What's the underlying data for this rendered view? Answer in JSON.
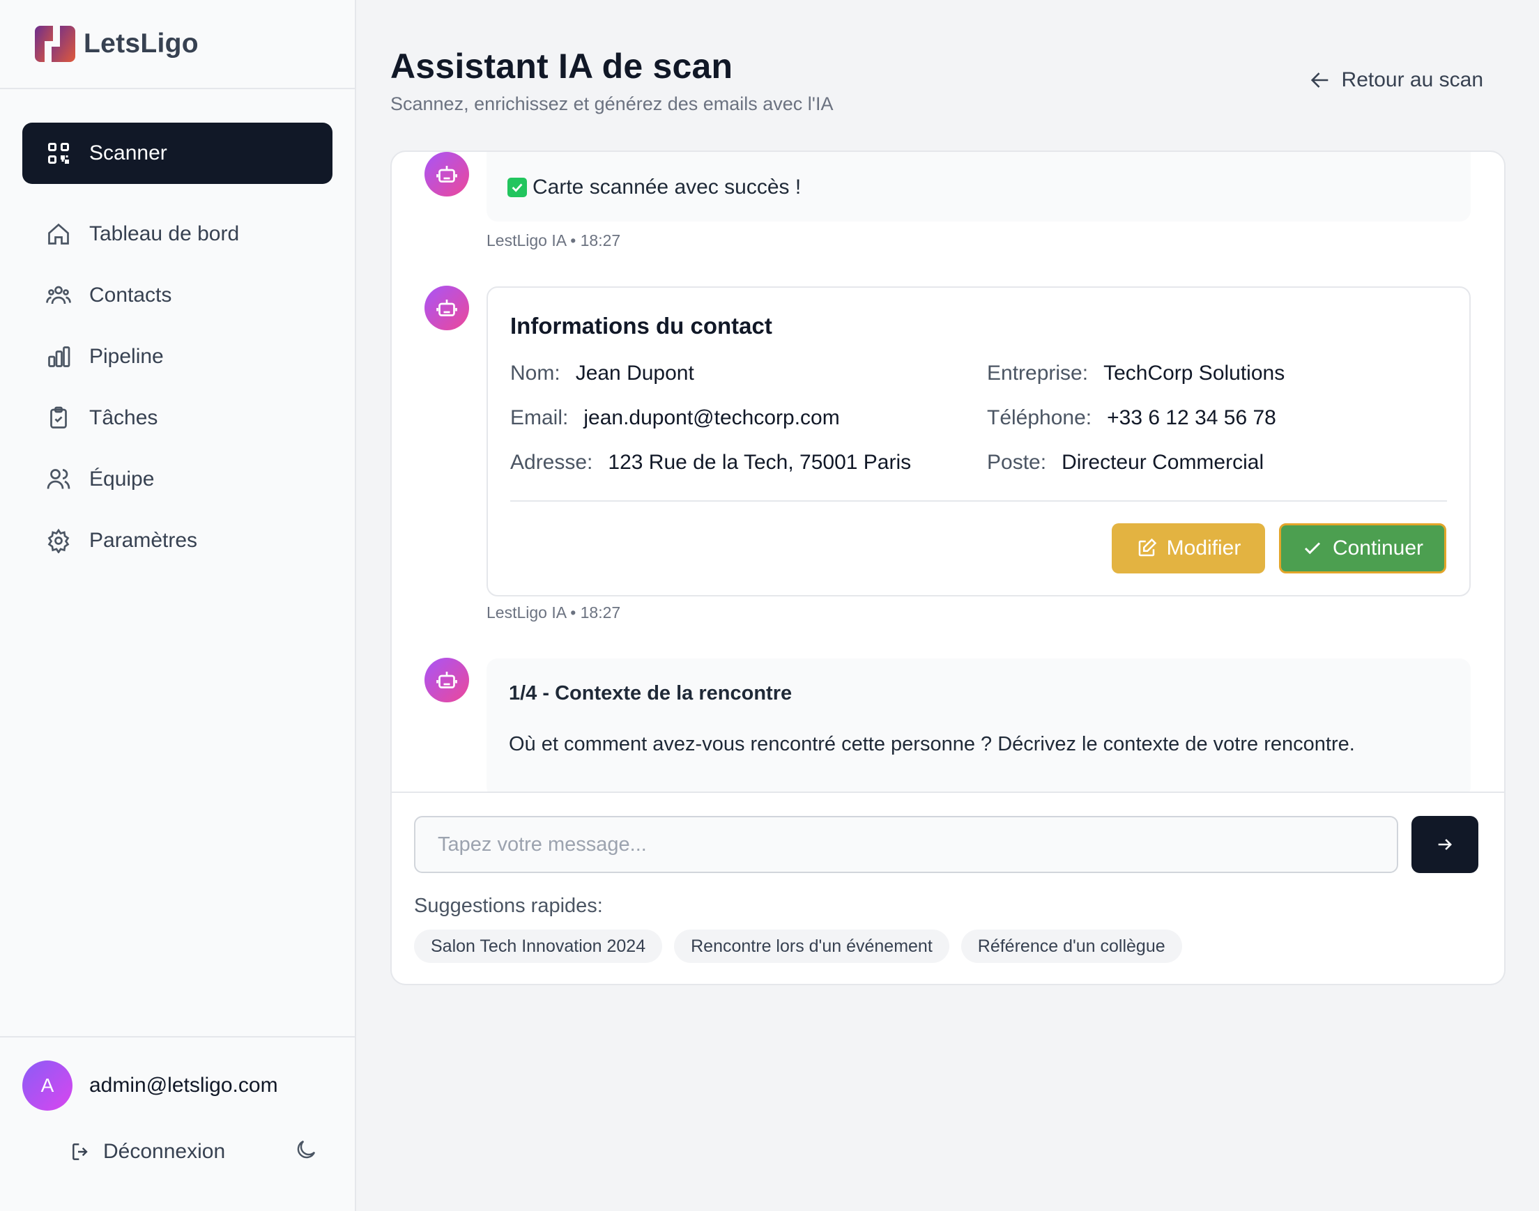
{
  "brand": {
    "name": "LetsLigo"
  },
  "sidebar": {
    "items": [
      {
        "label": "Scanner",
        "icon": "qr-scan-icon",
        "active": true
      },
      {
        "label": "Tableau de bord",
        "icon": "home-icon"
      },
      {
        "label": "Contacts",
        "icon": "users-icon"
      },
      {
        "label": "Pipeline",
        "icon": "bar-chart-icon"
      },
      {
        "label": "Tâches",
        "icon": "clipboard-check-icon"
      },
      {
        "label": "Équipe",
        "icon": "team-icon"
      },
      {
        "label": "Paramètres",
        "icon": "gear-icon"
      }
    ],
    "user": {
      "avatar_letter": "A",
      "email": "admin@letsligo.com"
    },
    "logout_label": "Déconnexion"
  },
  "header": {
    "title": "Assistant IA de scan",
    "subtitle": "Scannez, enrichissez et générez des emails avec l'IA",
    "back_label": "Retour au scan"
  },
  "chat": {
    "messages": [
      {
        "text": "Carte scannée avec succès !",
        "meta": "LestLigo IA • 18:27"
      },
      {
        "card_title": "Informations du contact",
        "fields": {
          "nom": {
            "label": "Nom:",
            "value": "Jean Dupont"
          },
          "entreprise": {
            "label": "Entreprise:",
            "value": "TechCorp Solutions"
          },
          "email": {
            "label": "Email:",
            "value": "jean.dupont@techcorp.com"
          },
          "telephone": {
            "label": "Téléphone:",
            "value": "+33 6 12 34 56 78"
          },
          "adresse": {
            "label": "Adresse:",
            "value": "123 Rue de la Tech, 75001 Paris"
          },
          "poste": {
            "label": "Poste:",
            "value": "Directeur Commercial"
          }
        },
        "modify_label": "Modifier",
        "continue_label": "Continuer",
        "meta": "LestLigo IA • 18:27"
      },
      {
        "title": "1/4 - Contexte de la rencontre",
        "text": "Où et comment avez-vous rencontré cette personne ? Décrivez le contexte de votre rencontre."
      }
    ],
    "input": {
      "placeholder": "Tapez votre message...",
      "value": ""
    },
    "suggestions_label": "Suggestions rapides:",
    "suggestions": [
      "Salon Tech Innovation 2024",
      "Rencontre lors d'un événement",
      "Référence d'un collègue"
    ]
  },
  "colors": {
    "active_nav": "#111827",
    "modify_button": "#e3b341",
    "continue_button": "#4c9f50",
    "continue_border": "#e3a52a",
    "bot_avatar_gradient": [
      "#a855f7",
      "#ec4899"
    ]
  }
}
